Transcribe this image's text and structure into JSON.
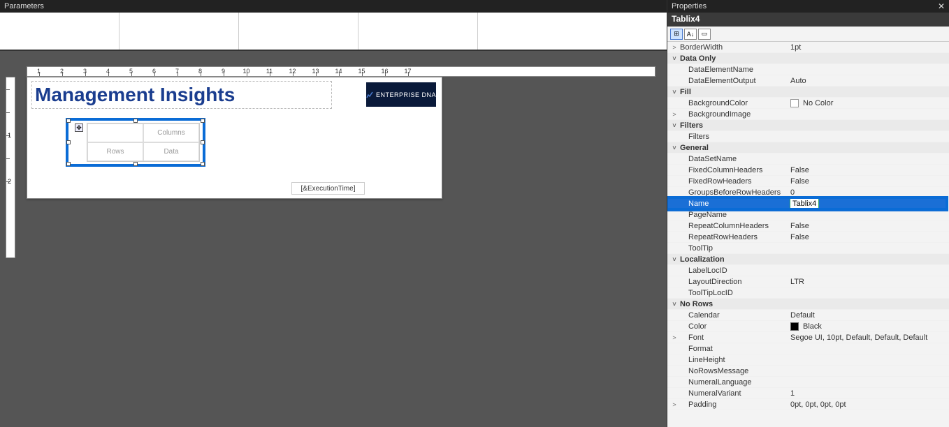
{
  "parameters_label": "Parameters",
  "ruler_ticks": [
    "1",
    "2",
    "3",
    "4",
    "5",
    "6",
    "7",
    "8",
    "9",
    "10",
    "11",
    "12",
    "13",
    "14",
    "15",
    "16",
    "17"
  ],
  "vruler_ticks": [
    "",
    "",
    "1",
    "",
    "2"
  ],
  "report": {
    "title": "Management Insights",
    "logo_text": "ENTERPRISE DNA",
    "tablix_labels": {
      "blank": "",
      "columns": "Columns",
      "rows": "Rows",
      "data": "Data"
    },
    "exec_time": "[&ExecutionTime]"
  },
  "properties": {
    "panel_title": "Properties",
    "object_name": "Tablix4",
    "toolbar": {
      "categorized": "⊞",
      "alpha": "A↓",
      "pages": "▭"
    },
    "rows": [
      {
        "type": "item",
        "expander": ">",
        "name": "BorderWidth",
        "value": "1pt"
      },
      {
        "type": "cat",
        "expander": "˅",
        "name": "Data Only"
      },
      {
        "type": "item",
        "indent": true,
        "name": "DataElementName",
        "value": ""
      },
      {
        "type": "item",
        "indent": true,
        "name": "DataElementOutput",
        "value": "Auto"
      },
      {
        "type": "cat",
        "expander": "˅",
        "name": "Fill"
      },
      {
        "type": "item",
        "indent": true,
        "name": "BackgroundColor",
        "value": "No Color",
        "swatch": "#ffffff",
        "swatchBorder": true
      },
      {
        "type": "item",
        "expander": ">",
        "indent": true,
        "name": "BackgroundImage",
        "value": ""
      },
      {
        "type": "cat",
        "expander": "˅",
        "name": "Filters"
      },
      {
        "type": "item",
        "indent": true,
        "name": "Filters",
        "value": ""
      },
      {
        "type": "cat",
        "expander": "˅",
        "name": "General"
      },
      {
        "type": "item",
        "indent": true,
        "name": "DataSetName",
        "value": ""
      },
      {
        "type": "item",
        "indent": true,
        "name": "FixedColumnHeaders",
        "value": "False"
      },
      {
        "type": "item",
        "indent": true,
        "name": "FixedRowHeaders",
        "value": "False"
      },
      {
        "type": "item",
        "indent": true,
        "name": "GroupsBeforeRowHeaders",
        "value": "0"
      },
      {
        "type": "hl",
        "indent": true,
        "name": "Name",
        "value": "Tablix4"
      },
      {
        "type": "item",
        "indent": true,
        "name": "PageName",
        "value": ""
      },
      {
        "type": "item",
        "indent": true,
        "name": "RepeatColumnHeaders",
        "value": "False"
      },
      {
        "type": "item",
        "indent": true,
        "name": "RepeatRowHeaders",
        "value": "False"
      },
      {
        "type": "item",
        "indent": true,
        "name": "ToolTip",
        "value": ""
      },
      {
        "type": "cat",
        "expander": "˅",
        "name": "Localization"
      },
      {
        "type": "item",
        "indent": true,
        "name": "LabelLocID",
        "value": ""
      },
      {
        "type": "item",
        "indent": true,
        "name": "LayoutDirection",
        "value": "LTR"
      },
      {
        "type": "item",
        "indent": true,
        "name": "ToolTipLocID",
        "value": ""
      },
      {
        "type": "cat",
        "expander": "˅",
        "name": "No Rows"
      },
      {
        "type": "item",
        "indent": true,
        "name": "Calendar",
        "value": "Default"
      },
      {
        "type": "item",
        "indent": true,
        "name": "Color",
        "value": "Black",
        "swatch": "#000000"
      },
      {
        "type": "item",
        "expander": ">",
        "indent": true,
        "name": "Font",
        "value": "Segoe UI, 10pt, Default, Default, Default"
      },
      {
        "type": "item",
        "indent": true,
        "name": "Format",
        "value": ""
      },
      {
        "type": "item",
        "indent": true,
        "name": "LineHeight",
        "value": ""
      },
      {
        "type": "item",
        "indent": true,
        "name": "NoRowsMessage",
        "value": ""
      },
      {
        "type": "item",
        "indent": true,
        "name": "NumeralLanguage",
        "value": ""
      },
      {
        "type": "item",
        "indent": true,
        "name": "NumeralVariant",
        "value": "1"
      },
      {
        "type": "item",
        "expander": ">",
        "indent": true,
        "name": "Padding",
        "value": "0pt, 0pt, 0pt, 0pt"
      }
    ]
  }
}
